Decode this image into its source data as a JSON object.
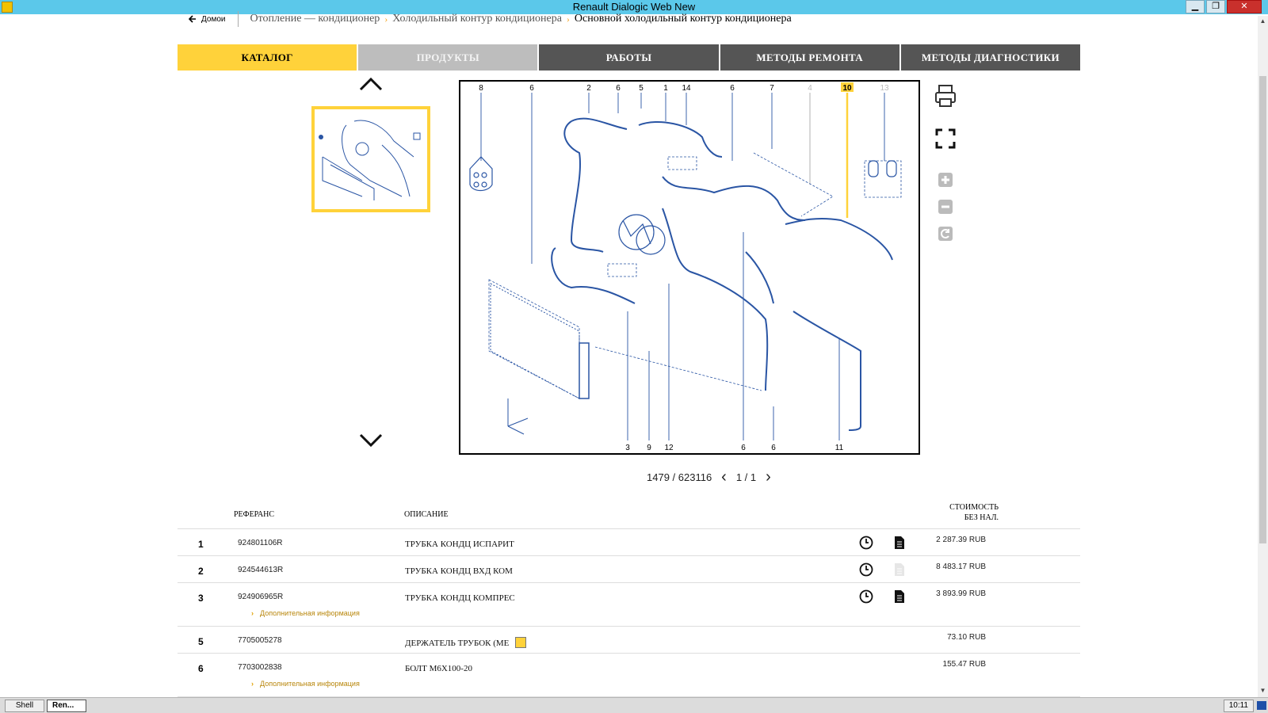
{
  "window": {
    "title": "Renault Dialogic Web New",
    "buttons": [
      "▁",
      "❐",
      "✕"
    ]
  },
  "breadcrumb": {
    "home": "Домои",
    "items": [
      "Отопление — кондиционер",
      "Холодильный контур кондиционера"
    ],
    "current": "Основной холодильный контур кондиционера"
  },
  "tabs": [
    {
      "label": "КАТАЛОГ",
      "state": "active"
    },
    {
      "label": "ПРОДУКТЫ",
      "state": "disabled"
    },
    {
      "label": "РАБОТЫ",
      "state": "normal"
    },
    {
      "label": "МЕТОДЫ РЕМОНТА",
      "state": "normal"
    },
    {
      "label": "МЕТОДЫ ДИАГНОСТИКИ",
      "state": "normal"
    }
  ],
  "diagram": {
    "top_labels": [
      "8",
      "6",
      "2",
      "6",
      "5",
      "1",
      "14",
      "6",
      "7",
      "4",
      "10",
      "13"
    ],
    "highlighted": "10",
    "bottom_labels": [
      "3",
      "9",
      "12",
      "6",
      "6",
      "11"
    ],
    "accent": "#ffd23a",
    "line_color": "#2a55a4"
  },
  "pager": {
    "image_id": "1479 / 623116",
    "page": "1 / 1"
  },
  "table": {
    "headers": {
      "ref": "РЕФЕРАНС",
      "desc": "ОПИСАНИЕ",
      "cost_line1": "СТОИМОСТЬ",
      "cost_line2": "БЕЗ НАЛ."
    },
    "more_label": "Дополнительная информация",
    "rows": [
      {
        "num": "1",
        "ref": "924801106R",
        "desc": "ТРУБКА КОНДЦ ИСПАРИТ",
        "price": "2 287.39 RUB"
      },
      {
        "num": "2",
        "ref": "924544613R",
        "desc": "ТРУБКА КОНДЦ ВХД КОМ",
        "price": "8 483.17 RUB"
      },
      {
        "num": "3",
        "ref": "924906965R",
        "desc": "ТРУБКА КОНДЦ КОМПРЕС",
        "price": "3 893.99 RUB"
      },
      {
        "num": "5",
        "ref": "7705005278",
        "desc": "ДЕРЖАТЕЛЬ ТРУБОК (МЕ",
        "price": "73.10 RUB"
      },
      {
        "num": "6",
        "ref": "7703002838",
        "desc": "БОЛТ М6Х100-20",
        "price": "155.47 RUB"
      }
    ]
  },
  "taskbar": {
    "shell": "Shell",
    "app": "Ren...",
    "time": "10:11"
  }
}
